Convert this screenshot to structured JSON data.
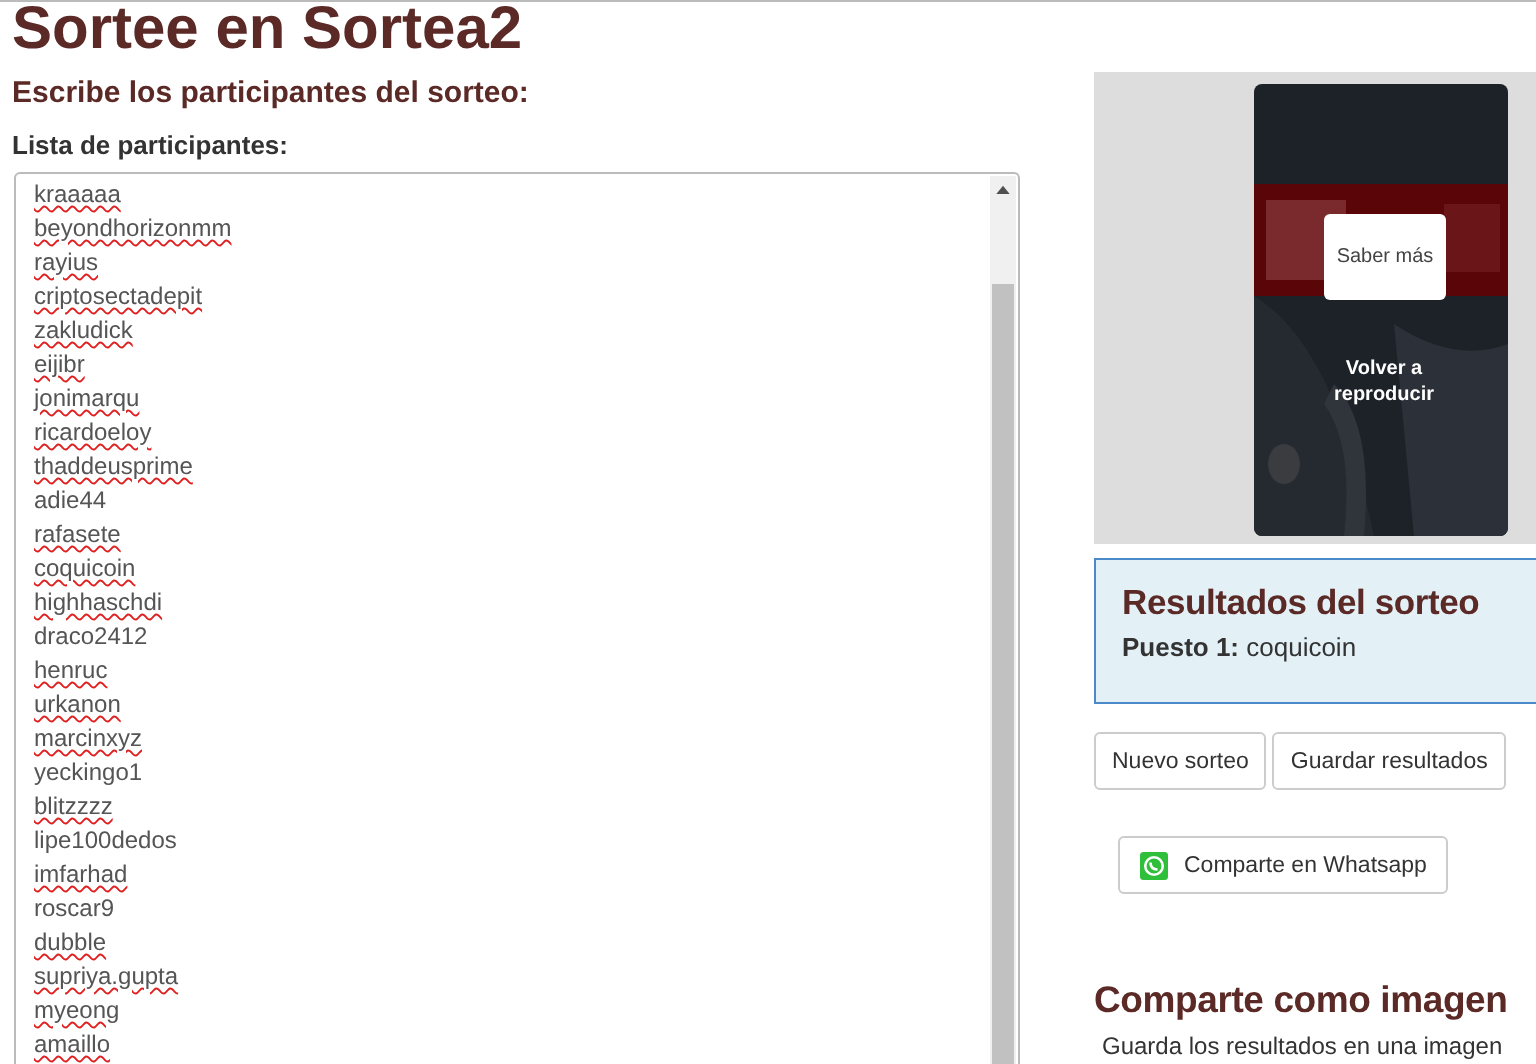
{
  "title": "Sortee en Sortea2",
  "subtitle": "Escribe los participantes del sorteo:",
  "list_label": "Lista de participantes:",
  "participants": [
    {
      "name": "kraaaaa",
      "misspelled": true
    },
    {
      "name": "beyondhorizonmm",
      "misspelled": true
    },
    {
      "name": "rayius",
      "misspelled": true
    },
    {
      "name": "criptosectadepit",
      "misspelled": true
    },
    {
      "name": "zakludick",
      "misspelled": true
    },
    {
      "name": "eijibr",
      "misspelled": true
    },
    {
      "name": "jonimarqu",
      "misspelled": true
    },
    {
      "name": "ricardoeloy",
      "misspelled": true
    },
    {
      "name": "thaddeusprime",
      "misspelled": true
    },
    {
      "name": "adie44",
      "misspelled": false
    },
    {
      "name": "rafasete",
      "misspelled": true
    },
    {
      "name": "coquicoin",
      "misspelled": true
    },
    {
      "name": "highhaschdi",
      "misspelled": true
    },
    {
      "name": "draco2412",
      "misspelled": false
    },
    {
      "name": "henruc",
      "misspelled": true
    },
    {
      "name": "urkanon",
      "misspelled": true
    },
    {
      "name": "marcinxyz",
      "misspelled": true
    },
    {
      "name": "yeckingo1",
      "misspelled": false
    },
    {
      "name": "blitzzzz",
      "misspelled": true
    },
    {
      "name": "lipe100dedos",
      "misspelled": false
    },
    {
      "name": "imfarhad",
      "misspelled": true
    },
    {
      "name": "roscar9",
      "misspelled": false
    },
    {
      "name": "dubble",
      "misspelled": true
    },
    {
      "name": "supriya.gupta",
      "misspelled": true
    },
    {
      "name": "myeong",
      "misspelled": true
    },
    {
      "name": "amaillo",
      "misspelled": true
    }
  ],
  "ad": {
    "kind": "picture",
    "learn_more": "Saber más",
    "replay": "Volver a reproducir"
  },
  "results": {
    "title": "Resultados del sorteo",
    "places": [
      {
        "label": "Puesto 1:",
        "winner": "coquicoin"
      }
    ]
  },
  "buttons": [
    "Nuevo sorteo",
    "Guardar resultados"
  ],
  "whatsapp": "Comparte en Whatsapp",
  "share_image": {
    "title": "Comparte como imagen",
    "text": "Guarda los resultados en una imagen"
  }
}
